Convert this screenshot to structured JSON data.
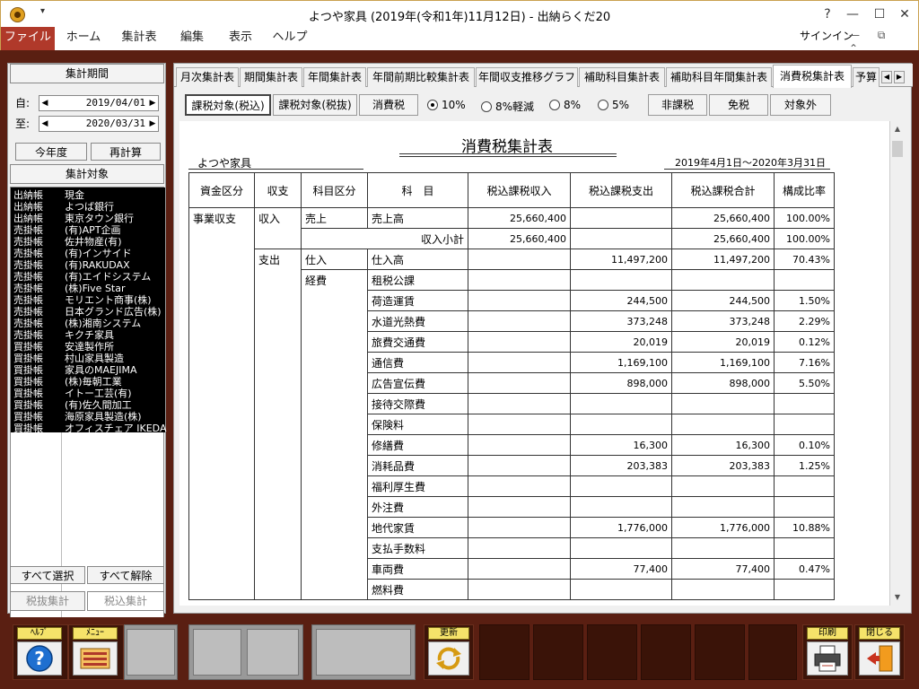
{
  "window": {
    "title": "よつや家具 (2019年(令和1年)11月12日) - 出納らくだ20",
    "qat": "▾",
    "help_btn": "?",
    "min_btn": "—",
    "max_btn": "☐",
    "close_btn": "✕"
  },
  "menu": {
    "items": [
      "ファイル",
      "ホーム",
      "集計表",
      "編集",
      "表示",
      "ヘルプ"
    ],
    "signin": "サインイン",
    "ribbon_controls": "— ⧉ ⌃"
  },
  "left": {
    "period_button": "集計期間",
    "from_label": "自:",
    "to_label": "至:",
    "from_date": "2019/04/01",
    "to_date": "2020/03/31",
    "this_year_button": "今年度",
    "recalc_button": "再計算",
    "target_header": "集計対象",
    "targets": [
      {
        "kind": "出納帳",
        "name": "現金"
      },
      {
        "kind": "出納帳",
        "name": "よつば銀行"
      },
      {
        "kind": "出納帳",
        "name": "東京タウン銀行"
      },
      {
        "kind": "売掛帳",
        "name": "(有)APT企画"
      },
      {
        "kind": "売掛帳",
        "name": "佐井物産(有)"
      },
      {
        "kind": "売掛帳",
        "name": "(有)インサイド"
      },
      {
        "kind": "売掛帳",
        "name": "(有)RAKUDAX"
      },
      {
        "kind": "売掛帳",
        "name": "(有)エイドシステム"
      },
      {
        "kind": "売掛帳",
        "name": "(株)Five Star"
      },
      {
        "kind": "売掛帳",
        "name": "モリエント商事(株)"
      },
      {
        "kind": "売掛帳",
        "name": "日本グランド広告(株)"
      },
      {
        "kind": "売掛帳",
        "name": "(株)湘南システム"
      },
      {
        "kind": "売掛帳",
        "name": "キクチ家具"
      },
      {
        "kind": "買掛帳",
        "name": "安達製作所"
      },
      {
        "kind": "買掛帳",
        "name": "村山家具製造"
      },
      {
        "kind": "買掛帳",
        "name": "家具のMAEJIMA"
      },
      {
        "kind": "買掛帳",
        "name": "(株)毎朝工業"
      },
      {
        "kind": "買掛帳",
        "name": "イトー工芸(有)"
      },
      {
        "kind": "買掛帳",
        "name": "(有)佐久間加工"
      },
      {
        "kind": "買掛帳",
        "name": "海原家具製造(株)"
      },
      {
        "kind": "買掛帳",
        "name": "オフィスチェア IKEDA"
      }
    ],
    "select_all_button": "すべて選択",
    "deselect_all_button": "すべて解除",
    "tax_excl_tab": "税抜集計",
    "tax_incl_tab": "税込集計"
  },
  "tabs": [
    "月次集計表",
    "期間集計表",
    "年間集計表",
    "年間前期比較集計表",
    "年間収支推移グラフ",
    "補助科目集計表",
    "補助科目年間集計表",
    "消費税集計表",
    "予算"
  ],
  "tab_scroll": {
    "left": "◀",
    "right": "▶"
  },
  "toolbar": {
    "btn_taxable_incl": "課税対象(税込)",
    "btn_taxable_excl": "課税対象(税抜)",
    "btn_consumption_tax": "消費税",
    "radio_10": "10%",
    "radio_8r": "8%軽減",
    "radio_8": "8%",
    "radio_5": "5%",
    "btn_non_taxable": "非課税",
    "btn_exempt": "免税",
    "btn_excluded": "対象外"
  },
  "report": {
    "title": "消費税集計表",
    "company": "よつや家具",
    "period": "2019年4月1日～2020年3月31日",
    "headers": [
      "資金区分",
      "収支",
      "科目区分",
      "科　目",
      "税込課税収入",
      "税込課税支出",
      "税込課税合計",
      "構成比率"
    ],
    "fund_category": "事業収支",
    "income_label": "収入",
    "expense_label": "支出",
    "sales_category": "売上",
    "purchase_category": "仕入",
    "expense_category": "経費",
    "rows": [
      {
        "item": "売上高",
        "income": "25,660,400",
        "expense": "",
        "total": "25,660,400",
        "ratio": "100.00%"
      },
      {
        "item": "収入小計",
        "income": "25,660,400",
        "expense": "",
        "total": "25,660,400",
        "ratio": "100.00%"
      },
      {
        "item": "仕入高",
        "income": "",
        "expense": "11,497,200",
        "total": "11,497,200",
        "ratio": "70.43%"
      },
      {
        "item": "租税公課",
        "income": "",
        "expense": "",
        "total": "",
        "ratio": ""
      },
      {
        "item": "荷造運賃",
        "income": "",
        "expense": "244,500",
        "total": "244,500",
        "ratio": "1.50%"
      },
      {
        "item": "水道光熱費",
        "income": "",
        "expense": "373,248",
        "total": "373,248",
        "ratio": "2.29%"
      },
      {
        "item": "旅費交通費",
        "income": "",
        "expense": "20,019",
        "total": "20,019",
        "ratio": "0.12%"
      },
      {
        "item": "通信費",
        "income": "",
        "expense": "1,169,100",
        "total": "1,169,100",
        "ratio": "7.16%"
      },
      {
        "item": "広告宣伝費",
        "income": "",
        "expense": "898,000",
        "total": "898,000",
        "ratio": "5.50%"
      },
      {
        "item": "接待交際費",
        "income": "",
        "expense": "",
        "total": "",
        "ratio": ""
      },
      {
        "item": "保険料",
        "income": "",
        "expense": "",
        "total": "",
        "ratio": ""
      },
      {
        "item": "修繕費",
        "income": "",
        "expense": "16,300",
        "total": "16,300",
        "ratio": "0.10%"
      },
      {
        "item": "消耗品費",
        "income": "",
        "expense": "203,383",
        "total": "203,383",
        "ratio": "1.25%"
      },
      {
        "item": "福利厚生費",
        "income": "",
        "expense": "",
        "total": "",
        "ratio": ""
      },
      {
        "item": "外注費",
        "income": "",
        "expense": "",
        "total": "",
        "ratio": ""
      },
      {
        "item": "地代家賃",
        "income": "",
        "expense": "1,776,000",
        "total": "1,776,000",
        "ratio": "10.88%"
      },
      {
        "item": "支払手数料",
        "income": "",
        "expense": "",
        "total": "",
        "ratio": ""
      },
      {
        "item": "車両費",
        "income": "",
        "expense": "77,400",
        "total": "77,400",
        "ratio": "0.47%"
      },
      {
        "item": "燃料費",
        "income": "",
        "expense": "",
        "total": "",
        "ratio": ""
      }
    ]
  },
  "bottom": {
    "help_label": "ﾍﾙﾌﾟ",
    "menu_label": "ﾒﾆｭｰ",
    "refresh_label": "更新",
    "print_label": "印刷",
    "close_label": "閉じる"
  },
  "colors": {
    "accent": "#b0392a",
    "frame": "#5a1f12",
    "key_cap": "#f5e36a"
  }
}
